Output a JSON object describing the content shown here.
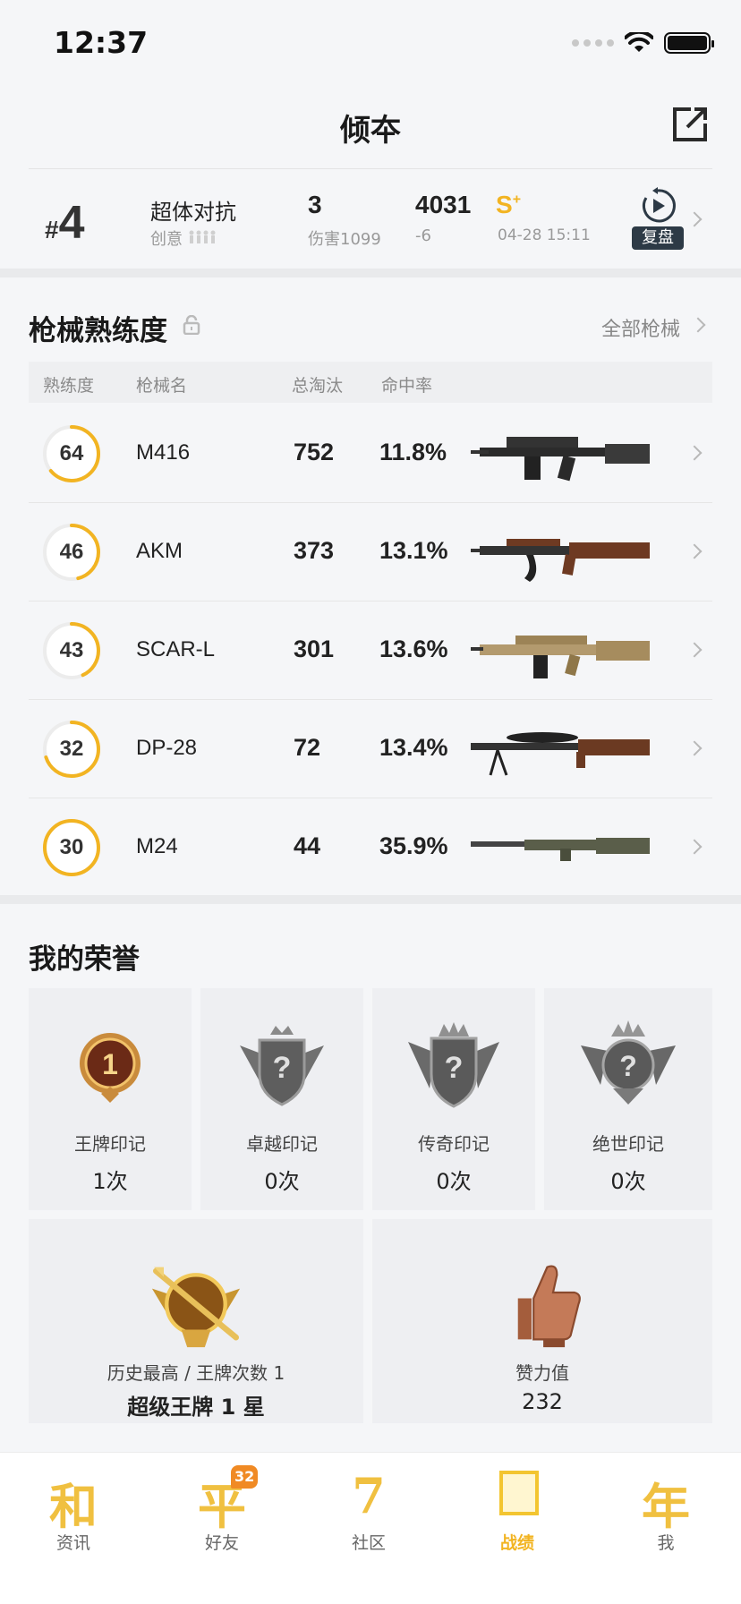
{
  "status_bar": {
    "time": "12:37"
  },
  "header": {
    "title": "倾夲"
  },
  "match": {
    "rank_hash": "#",
    "rank_num": "4",
    "mode": "超体对抗",
    "mode_sub": "创意",
    "kills": "3",
    "damage": "伤害1099",
    "score": "4031",
    "score_delta": "-6",
    "grade": "S",
    "grade_sup": "+",
    "time": "04-28 15:11",
    "replay_label": "复盘"
  },
  "weapons": {
    "title": "枪械熟练度",
    "all_link": "全部枪械",
    "headers": {
      "mastery": "熟练度",
      "name": "枪械名",
      "kills": "总淘汰",
      "hit_rate": "命中率"
    },
    "rows": [
      {
        "mastery": "64",
        "mastery_pct": 0.64,
        "name": "M416",
        "kills": "752",
        "hit_rate": "11.8%"
      },
      {
        "mastery": "46",
        "mastery_pct": 0.46,
        "name": "AKM",
        "kills": "373",
        "hit_rate": "13.1%"
      },
      {
        "mastery": "43",
        "mastery_pct": 0.43,
        "name": "SCAR-L",
        "kills": "301",
        "hit_rate": "13.6%"
      },
      {
        "mastery": "32",
        "mastery_pct": 0.7,
        "name": "DP-28",
        "kills": "72",
        "hit_rate": "13.4%"
      },
      {
        "mastery": "30",
        "mastery_pct": 1.0,
        "name": "M24",
        "kills": "44",
        "hit_rate": "35.9%"
      }
    ]
  },
  "honors": {
    "title": "我的荣誉",
    "marks": [
      {
        "label": "王牌印记",
        "count": "1次",
        "badge_text": "1"
      },
      {
        "label": "卓越印记",
        "count": "0次",
        "badge_text": "?"
      },
      {
        "label": "传奇印记",
        "count": "0次",
        "badge_text": "?"
      },
      {
        "label": "绝世印记",
        "count": "0次",
        "badge_text": "?"
      }
    ],
    "highest": {
      "label": "历史最高 / 王牌次数 1",
      "value": "超级王牌 1 星"
    },
    "likes": {
      "label": "赞力值",
      "value": "232"
    }
  },
  "tabs": [
    {
      "glyph": "和",
      "label": "资讯"
    },
    {
      "glyph": "平",
      "label": "好友",
      "badge": "32"
    },
    {
      "glyph": "7",
      "label": "社区"
    },
    {
      "glyph": "",
      "label": "战绩",
      "active": true
    },
    {
      "glyph": "年",
      "label": "我"
    }
  ],
  "colors": {
    "accent": "#f2b422",
    "ring_track": "#e8e8e8",
    "bg": "#f5f6f8"
  }
}
